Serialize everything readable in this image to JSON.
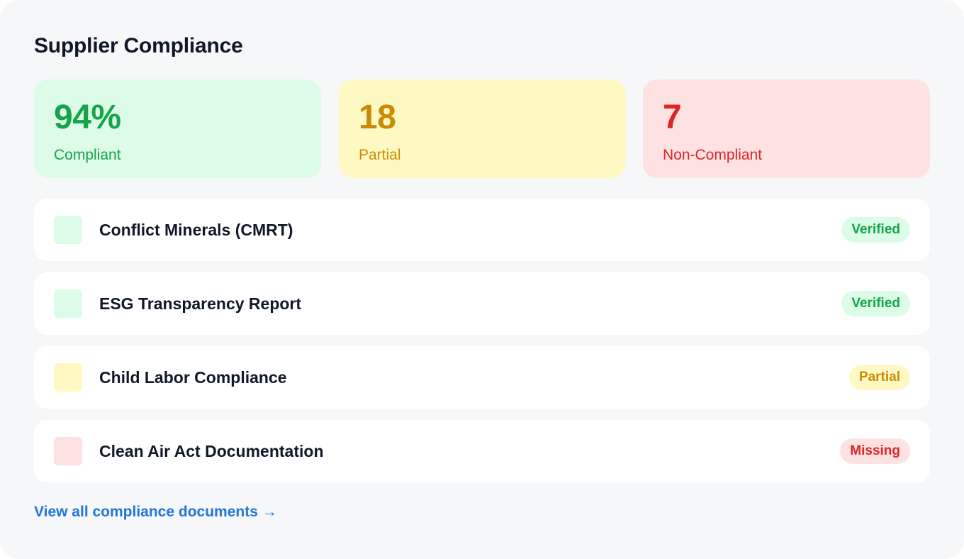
{
  "header": {
    "title": "Supplier Compliance"
  },
  "stats": [
    {
      "value": "94%",
      "label": "Compliant",
      "status": "green"
    },
    {
      "value": "18",
      "label": "Partial",
      "status": "yellow"
    },
    {
      "value": "7",
      "label": "Non-Compliant",
      "status": "red"
    }
  ],
  "documents": [
    {
      "name": "Conflict Minerals (CMRT)",
      "status": "Verified",
      "color": "green"
    },
    {
      "name": "ESG Transparency Report",
      "status": "Verified",
      "color": "green"
    },
    {
      "name": "Child Labor Compliance",
      "status": "Partial",
      "color": "yellow"
    },
    {
      "name": "Clean Air Act Documentation",
      "status": "Missing",
      "color": "red"
    }
  ],
  "footer": {
    "link_label": "View all compliance documents →"
  },
  "colors": {
    "green": "#16a34a",
    "green_bg": "#dcfce8",
    "yellow": "#ca8a04",
    "yellow_bg": "#fef9c3",
    "red": "#dc2626",
    "red_bg": "#fee2e2",
    "link": "#2176d8",
    "card_bg": "#f6f7f9"
  }
}
